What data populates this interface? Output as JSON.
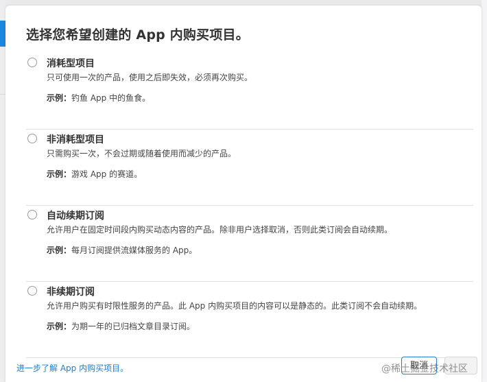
{
  "dialog": {
    "title": "选择您希望创建的 App 内购买项目。",
    "options": [
      {
        "title": "消耗型项目",
        "description": "只可使用一次的产品，使用之后即失效，必须再次购买。",
        "example_label": "示例：",
        "example_text": "钓鱼 App 中的鱼食。"
      },
      {
        "title": "非消耗型项目",
        "description": "只需购买一次，不会过期或随着使用而减少的产品。",
        "example_label": "示例：",
        "example_text": "游戏 App 的赛道。"
      },
      {
        "title": "自动续期订阅",
        "description": "允许用户在固定时间段内购买动态内容的产品。除非用户选择取消，否则此类订阅会自动续期。",
        "example_label": "示例：",
        "example_text": "每月订阅提供流媒体服务的 App。"
      },
      {
        "title": "非续期订阅",
        "description": "允许用户购买有时限性服务的产品。此 App 内购买项目的内容可以是静态的。此类订阅不会自动续期。",
        "example_label": "示例：",
        "example_text": "为期一年的已归档文章目录订阅。"
      }
    ],
    "footer_link": "进一步了解 App 内购买项目。",
    "cancel_label": "取消"
  },
  "watermark": "@稀土掘金技术社区",
  "colors": {
    "link": "#1a7fd4",
    "accent": "#1a88e0"
  }
}
